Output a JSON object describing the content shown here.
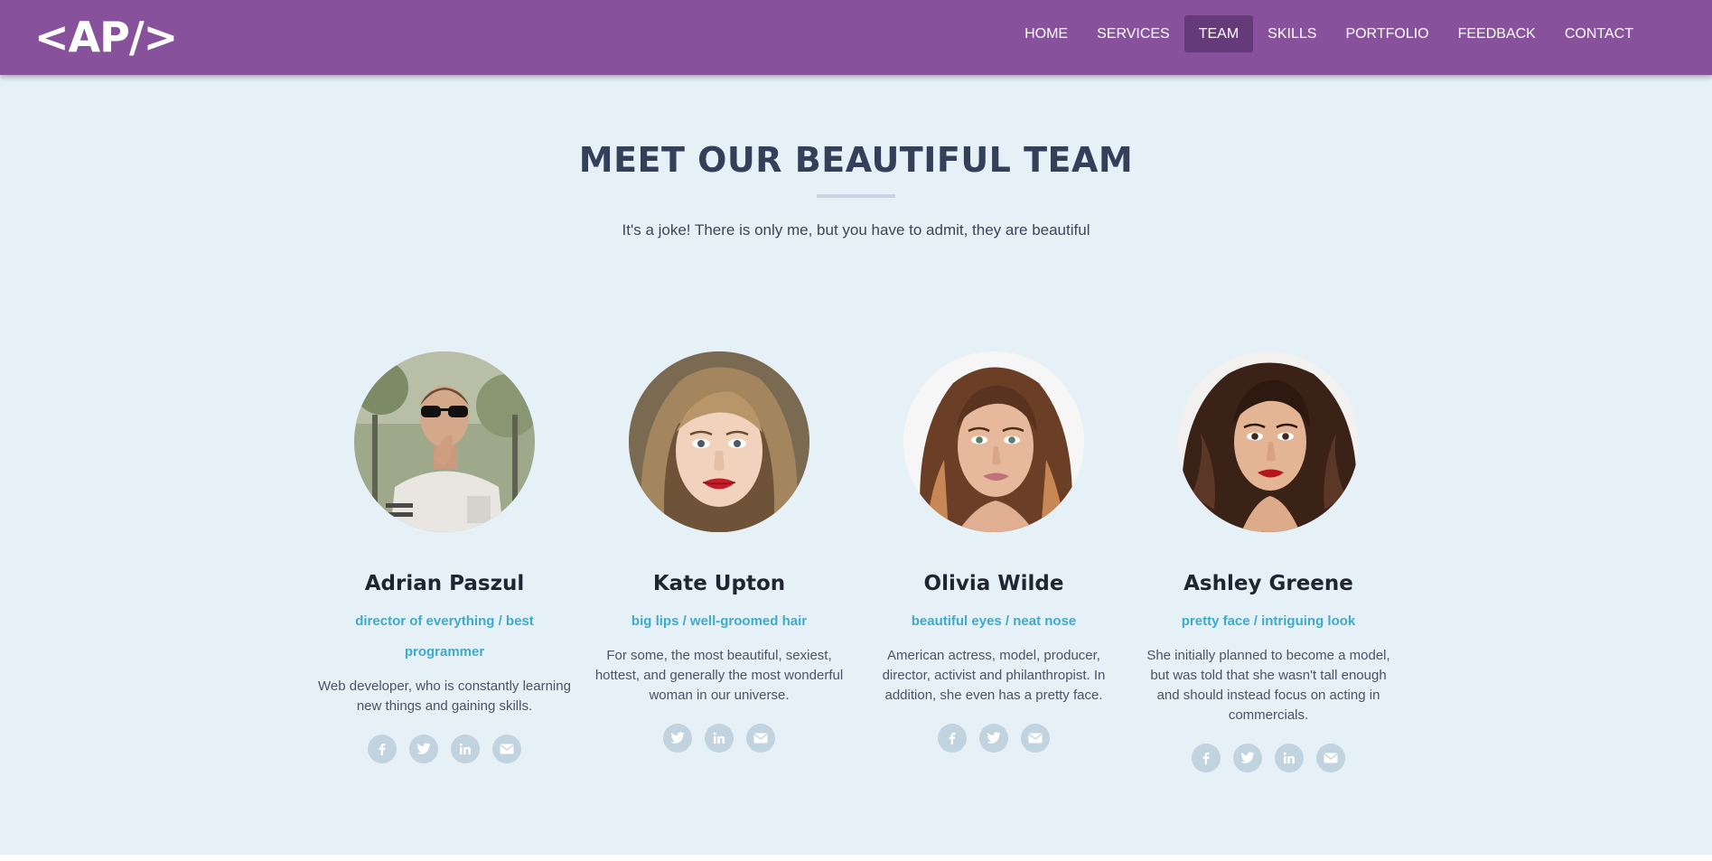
{
  "brand": {
    "logo": "<AP/>"
  },
  "nav": {
    "items": [
      {
        "label": "HOME"
      },
      {
        "label": "SERVICES"
      },
      {
        "label": "TEAM",
        "active": true
      },
      {
        "label": "SKILLS"
      },
      {
        "label": "PORTFOLIO"
      },
      {
        "label": "FEEDBACK"
      },
      {
        "label": "CONTACT"
      }
    ]
  },
  "team": {
    "title": "MEET OUR BEAUTIFUL TEAM",
    "subtitle": "It's a joke! There is only me, but you have to admit, they are beautiful",
    "members": [
      {
        "name": "Adrian Paszul",
        "role": "director of everything / best programmer",
        "description": "Web developer, who is constantly learning new things and gaining skills.",
        "socials": [
          "facebook-icon",
          "twitter-icon",
          "linkedin-icon",
          "email-icon"
        ]
      },
      {
        "name": "Kate Upton",
        "role": "big lips / well-groomed hair",
        "description": "For some, the most beautiful, sexiest, hottest, and generally the most wonderful woman in our universe.",
        "socials": [
          "twitter-icon",
          "linkedin-icon",
          "email-icon"
        ]
      },
      {
        "name": "Olivia Wilde",
        "role": "beautiful eyes / neat nose",
        "description": "American actress, model, producer, director, activist and philanthropist. In addition, she even has a pretty face.",
        "socials": [
          "facebook-icon",
          "twitter-icon",
          "email-icon"
        ]
      },
      {
        "name": "Ashley Greene",
        "role": "pretty face / intriguing look",
        "description": "She initially planned to become a model, but was told that she wasn't tall enough and should instead focus on acting in commercials.",
        "socials": [
          "facebook-icon",
          "twitter-icon",
          "linkedin-icon",
          "email-icon"
        ]
      }
    ]
  },
  "colors": {
    "navbar": "#87529b",
    "nav_active": "#653a78",
    "section_bg": "#e6f0f7",
    "role_accent": "#3daacf",
    "social_icon_bg": "#c2d3e0"
  }
}
